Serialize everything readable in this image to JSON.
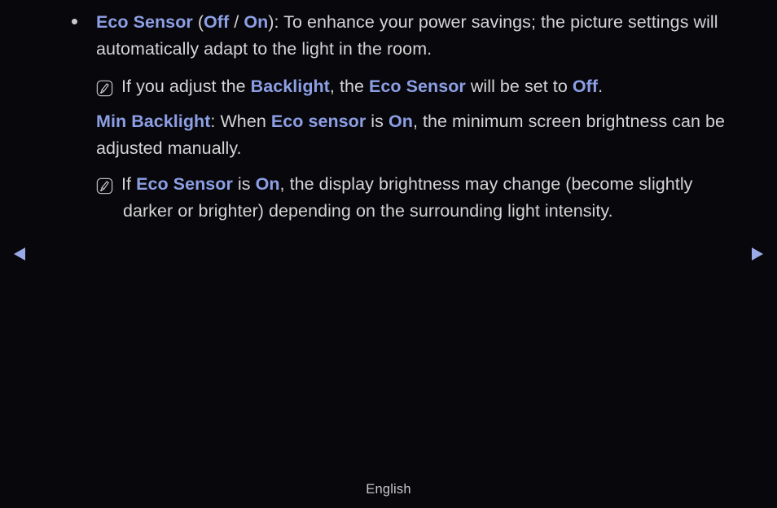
{
  "theme": {
    "background": "#07070c",
    "body_text": "#d4d4d4",
    "accent_blue": "#8d9fe4",
    "bullet_color": "#c9c9c9",
    "arrow_color": "#9aa9e8"
  },
  "content": {
    "bullet_item": {
      "bullet_glyph": "•",
      "term": "Eco Sensor",
      "open_paren": " (",
      "option_off": "Off",
      "separator": " / ",
      "option_on": "On",
      "close_paren": ")",
      "body": ": To enhance your power savings; the picture settings will automatically adapt to the light in the room."
    },
    "note_one": {
      "icon": "note-pencil-icon",
      "text_a": "If you adjust the ",
      "term_a": "Backlight",
      "text_b": ", the ",
      "term_b": "Eco Sensor",
      "text_c": " will be set to ",
      "term_c": "Off",
      "text_d": "."
    },
    "min_backlight": {
      "term": "Min Backlight",
      "text_a": ": When ",
      "term_b": "Eco sensor",
      "text_b": " is ",
      "term_c": "On",
      "text_c": ", the minimum screen brightness can be adjusted manually."
    },
    "note_two": {
      "icon": "note-pencil-icon",
      "text_a": "If ",
      "term_a": "Eco Sensor",
      "text_b": " is ",
      "term_b": "On",
      "text_c": ", the display brightness may change (become slightly darker or brighter) depending on the surrounding light intensity."
    }
  },
  "navigation": {
    "prev_icon": "triangle-left-icon",
    "next_icon": "triangle-right-icon"
  },
  "footer": {
    "language": "English"
  }
}
